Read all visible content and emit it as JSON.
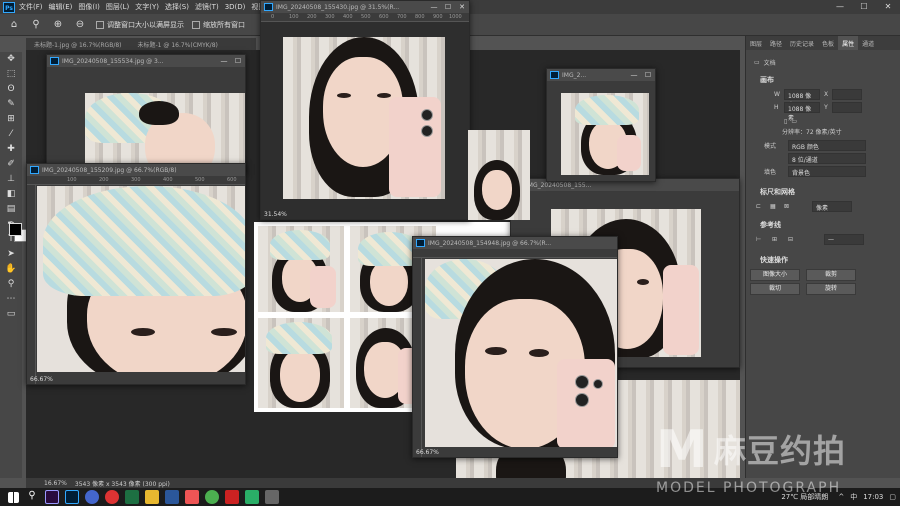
{
  "menubar": {
    "items": [
      "文件(F)",
      "编辑(E)",
      "图像(I)",
      "图层(L)",
      "文字(Y)",
      "选择(S)",
      "滤镜(T)",
      "3D(D)",
      "视图"
    ]
  },
  "window_controls": {
    "minimize": "—",
    "maximize": "☐",
    "close": "✕"
  },
  "optbar": {
    "check1": "调整窗口大小以满屏显示",
    "check2": "缩放所有窗口"
  },
  "doc_tabs": [
    "未标题-1.jpg @ 16.7%(RGB/8)",
    "未标题-1 @ 16.7%(CMYK/8)"
  ],
  "windows": {
    "w1": {
      "title": "IMG_20240508_155534.jpg @ 3...",
      "zoom": ""
    },
    "w2": {
      "title": "IMG_20240508_155430.jpg @ 31.5%(R...",
      "zoom": "31.54%"
    },
    "w3": {
      "title": "IMG_2...",
      "zoom": ""
    },
    "w4": {
      "title": "IMG_20240508_155209.jpg @ 66.7%(RGB/8)",
      "zoom": "66.67%"
    },
    "w5": {
      "title": "IMG_20240508_155...",
      "zoom": ""
    },
    "w6": {
      "title": "IMG_20240508_154948.jpg @ 66.7%(R...",
      "zoom": "66.67%"
    }
  },
  "ruler_ticks": {
    "w4": [
      "100",
      "200",
      "300",
      "400",
      "500",
      "600"
    ],
    "w2": [
      "0",
      "100",
      "200",
      "300",
      "400",
      "500",
      "600",
      "700",
      "800",
      "900",
      "1000"
    ]
  },
  "right_panel": {
    "tabs": [
      "图层",
      "路径",
      "历史记录",
      "色板",
      "属性",
      "通道"
    ],
    "active_tab": "属性",
    "doc_label": "文档",
    "canvas_section": "画布",
    "w_label": "W",
    "w_value": "1088 像素",
    "x_label": "X",
    "h_label": "H",
    "h_value": "1088 像素",
    "y_label": "Y",
    "resolution": "分辨率：72 像素/英寸",
    "mode_label": "模式",
    "mode_value": "RGB 颜色",
    "depth_value": "8 位/通道",
    "fill_label": "填色",
    "fill_value": "背景色",
    "rulers_section": "标尺和网格",
    "unit_value": "像素",
    "guides_section": "参考线",
    "quick_section": "快速操作",
    "btn_image_size": "图像大小",
    "btn_crop": "裁剪",
    "btn_trim": "裁切",
    "btn_rotate": "旋转"
  },
  "statusbar": {
    "zoom": "16.67%",
    "info": "3543 像素 x 3543 像素 (300 ppi)"
  },
  "watermark": {
    "letter": "M",
    "cn": "麻豆约拍",
    "en": "MODEL PHOTOGRAPH"
  },
  "tray": {
    "weather": "27℃ 局部晴朗",
    "lang": "中",
    "time": "17:03"
  },
  "colors": {
    "accent": "#31a8ff",
    "canvas": "#282828",
    "panel": "#474747"
  }
}
